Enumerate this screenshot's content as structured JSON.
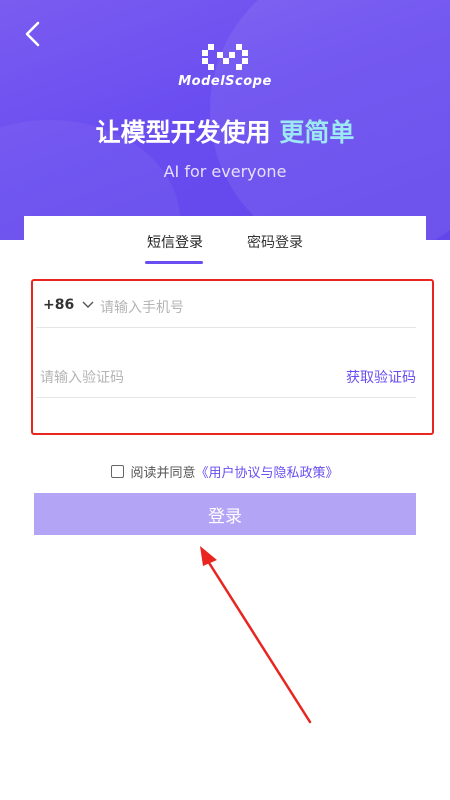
{
  "header": {
    "back_icon": "chevron-left-icon",
    "logo_icon": "modelscope-logo-icon",
    "logo_text": "ModelScope",
    "headline_main": "让模型开发使用",
    "headline_highlight": "更简单",
    "subtitle": "AI for everyone"
  },
  "tabs": [
    {
      "label": "短信登录",
      "active": true
    },
    {
      "label": "密码登录",
      "active": false
    }
  ],
  "form": {
    "country_code": "+86",
    "country_code_icon": "chevron-down-icon",
    "phone_placeholder": "请输入手机号",
    "phone_value": "",
    "code_placeholder": "请输入验证码",
    "code_value": "",
    "get_code_label": "获取验证码"
  },
  "agreement": {
    "checked": false,
    "prefix": "阅读并同意",
    "link": "《用户协议与隐私政策》"
  },
  "login_button": {
    "label": "登录"
  },
  "colors": {
    "brand": "#6a4df0",
    "hero_bg": "#6246ea",
    "highlight": "#9ee8f5",
    "button_disabled": "#b3a4f6",
    "annotation_red": "#e8251f"
  }
}
